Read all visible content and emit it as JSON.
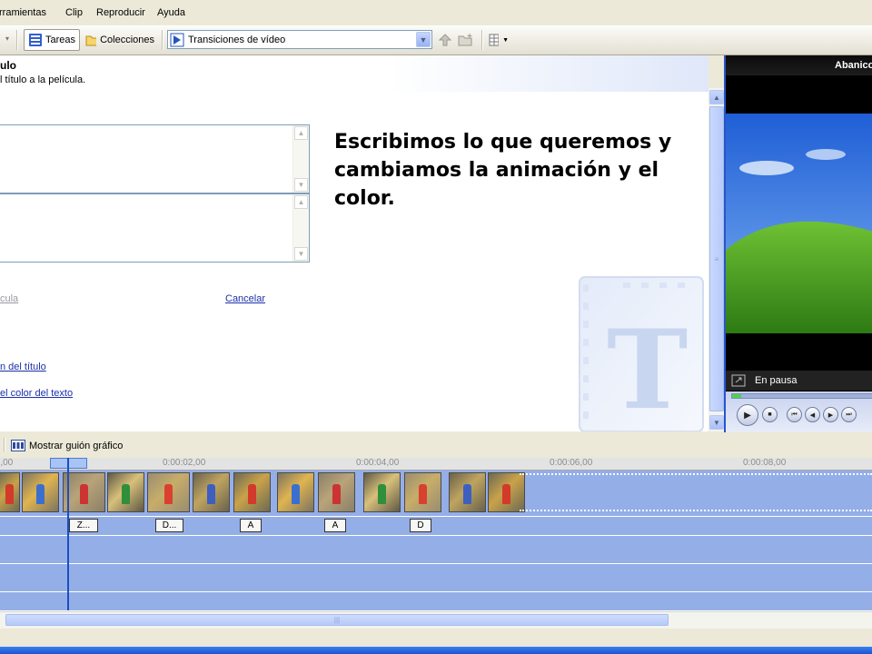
{
  "menu": {
    "items": [
      "rramientas",
      "Clip",
      "Reproducir",
      "Ayuda"
    ]
  },
  "toolbar": {
    "tasks_label": "Tareas",
    "collections_label": "Colecciones",
    "collection_selected": "Transiciones de vídeo"
  },
  "task_pane": {
    "title": "ulo",
    "subtitle": "l título a la película.",
    "callout": "Escribimos lo que queremos y cambiamos la animación y el color.",
    "link_done": "cula",
    "link_cancel": "Cancelar",
    "link_animation": "n del título",
    "link_text_color": "el color del texto"
  },
  "monitor": {
    "title": "Abanico",
    "status": "En pausa"
  },
  "timeline": {
    "storyboard_label": "Mostrar guión gráfico",
    "ruler_ticks": [
      "),00",
      "0:00:02,00",
      "0:00:04,00",
      "0:00:06,00",
      "0:00:08,00"
    ],
    "title_clips": [
      "Z...",
      "D...",
      "A",
      "A",
      "D"
    ]
  },
  "colors": {
    "timeline_track": "#94aee8",
    "link": "#1b2fa9",
    "playhead": "#1b4fbf"
  }
}
